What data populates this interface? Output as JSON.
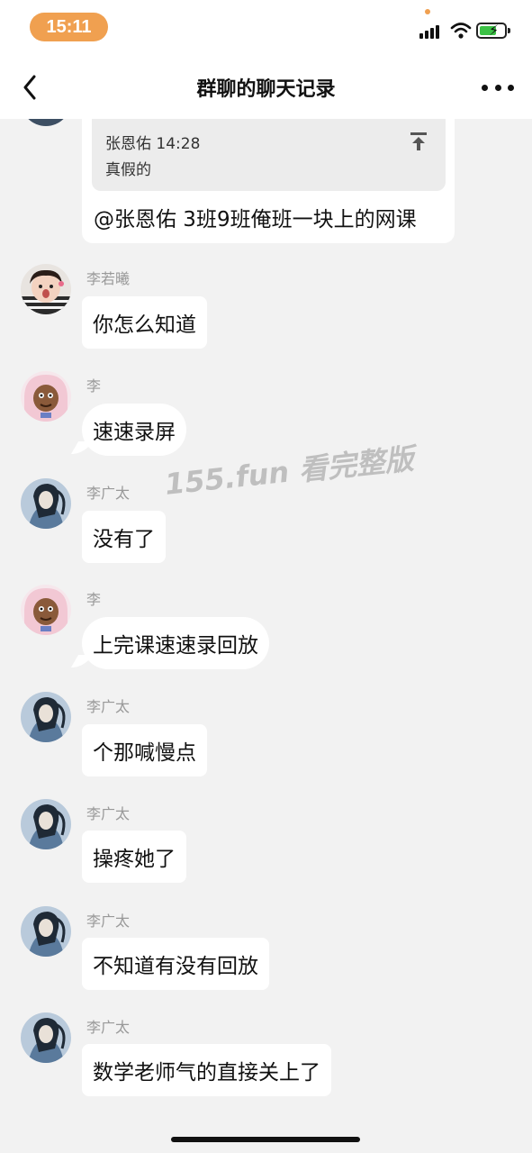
{
  "status_bar": {
    "time": "15:11",
    "accent_color": "#f0a050",
    "icons": [
      "signal-icon",
      "wifi-icon",
      "battery-charging-icon"
    ]
  },
  "nav": {
    "title": "群聊的聊天记录",
    "back_icon": "chevron-left-icon",
    "more_icon": "more-dots-icon"
  },
  "quote_message": {
    "quoted_sender_time": "张恩佑 14:28",
    "quoted_text": "真假的",
    "text": "@张恩佑 3班9班俺班一块上的网课",
    "pin_icon": "arrow-to-top-icon"
  },
  "messages": [
    {
      "sender": "李若曦",
      "text": "你怎么知道",
      "avatar": "child-avatar"
    },
    {
      "sender": "李",
      "text": "速速录屏",
      "avatar": "cartoon-avatar"
    },
    {
      "sender": "李广太",
      "text": "没有了",
      "avatar": "anime-avatar"
    },
    {
      "sender": "李",
      "text": "上完课速速录回放",
      "avatar": "cartoon-avatar"
    },
    {
      "sender": "李广太",
      "text": "个那喊慢点",
      "avatar": "anime-avatar"
    },
    {
      "sender": "李广太",
      "text": "操疼她了",
      "avatar": "anime-avatar"
    },
    {
      "sender": "李广太",
      "text": "不知道有没有回放",
      "avatar": "anime-avatar"
    },
    {
      "sender": "李广太",
      "text": "数学老师气的直接关上了",
      "avatar": "anime-avatar"
    }
  ],
  "watermark": "155.fun 看完整版",
  "colors": {
    "background": "#f2f2f2",
    "bubble": "#ffffff",
    "sender_name": "#999999"
  }
}
